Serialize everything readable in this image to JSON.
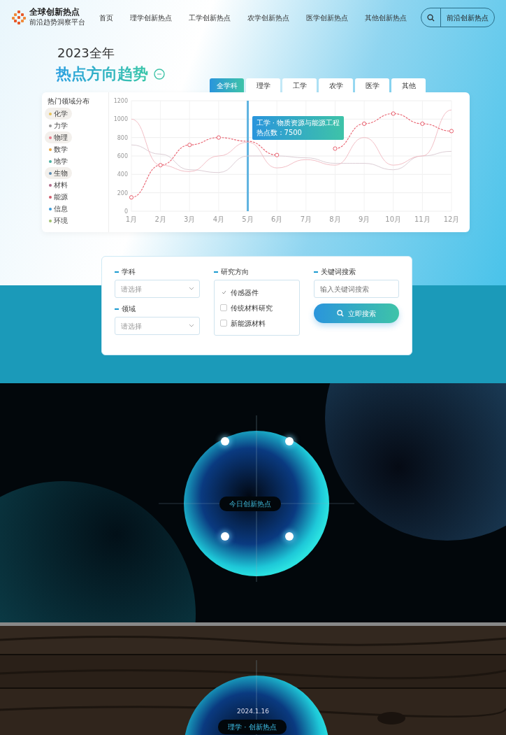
{
  "header": {
    "logo_title": "全球创新热点",
    "logo_subtitle": "前沿趋势洞察平台",
    "nav": [
      {
        "label": "首页",
        "selected": false
      },
      {
        "label": "理学创新热点",
        "selected": false
      },
      {
        "label": "工学创新热点",
        "selected": false
      },
      {
        "label": "农学创新热点",
        "selected": false
      },
      {
        "label": "医学创新热点",
        "selected": false
      },
      {
        "label": "其他创新热点",
        "selected": false
      }
    ],
    "action": "前沿创新热点"
  },
  "hero": {
    "year": "2023全年",
    "title": "热点方向趋势"
  },
  "tabs": [
    {
      "label": "全学科",
      "selected": true
    },
    {
      "label": "理学",
      "selected": false
    },
    {
      "label": "工学",
      "selected": false
    },
    {
      "label": "农学",
      "selected": false
    },
    {
      "label": "医学",
      "selected": false
    },
    {
      "label": "其他",
      "selected": false
    }
  ],
  "sidebar": {
    "title": "热门领域分布",
    "items": [
      {
        "label": "化学",
        "selected": true,
        "color": "#e8c35a"
      },
      {
        "label": "力学",
        "selected": false,
        "color": "#9a9a9a"
      },
      {
        "label": "物理",
        "selected": true,
        "color": "#e87a8a"
      },
      {
        "label": "数学",
        "selected": false,
        "color": "#e8a84a"
      },
      {
        "label": "地学",
        "selected": false,
        "color": "#4ab0a0"
      },
      {
        "label": "生物",
        "selected": true,
        "color": "#5a8ab0"
      },
      {
        "label": "材料",
        "selected": false,
        "color": "#b06a8a"
      },
      {
        "label": "能源",
        "selected": false,
        "color": "#d05a6a"
      },
      {
        "label": "信息",
        "selected": false,
        "color": "#3a9ad8"
      },
      {
        "label": "环境",
        "selected": false,
        "color": "#a0c070"
      }
    ]
  },
  "chart": {
    "chart_data": {
      "type": "line",
      "grid": true,
      "categories": [
        "1月",
        "2月",
        "3月",
        "4月",
        "5月",
        "6月",
        "7月",
        "8月",
        "9月",
        "10月",
        "11月",
        "12月"
      ],
      "yticks": [
        0,
        200,
        400,
        600,
        800,
        1000,
        1200
      ],
      "ylim": [
        0,
        1200
      ],
      "ref_lines": [
        {
          "axis": "x",
          "value": "5月"
        }
      ],
      "series": [
        {
          "color": "#e8606e",
          "line_style": "dashed",
          "marker": "circle",
          "values": [
            150,
            500,
            720,
            800,
            760,
            610,
            null,
            680,
            950,
            1060,
            950,
            870
          ]
        },
        {
          "color": "#f0b8c0",
          "values": [
            1000,
            500,
            430,
            600,
            750,
            470,
            560,
            500,
            800,
            500,
            600,
            1100
          ]
        },
        {
          "color": "#d8c8d0",
          "values": [
            720,
            620,
            450,
            420,
            600,
            600,
            580,
            520,
            520,
            450,
            600,
            650
          ]
        }
      ]
    },
    "tooltip": {
      "title": "工学 · 物质资源与能源工程",
      "value": "热点数：7500"
    }
  },
  "search": {
    "fields": [
      {
        "kind": "select",
        "label": "学科",
        "placeholder": "请选择"
      },
      {
        "kind": "select",
        "label": "领域",
        "placeholder": "请选择"
      },
      {
        "kind": "checklist",
        "label": "研究方向",
        "options": [
          {
            "label": "传感器件",
            "checked": true
          },
          {
            "label": "传统材料研究",
            "checked": false
          },
          {
            "label": "新能源材料",
            "checked": false
          }
        ]
      },
      {
        "kind": "text",
        "label": "关键词搜索",
        "placeholder": "输入关键词搜索"
      }
    ],
    "button": "立即搜索"
  },
  "today": {
    "label": "今日创新热点"
  },
  "daily": {
    "date": "2024.1.16",
    "label": "理学 · 创新热点"
  }
}
